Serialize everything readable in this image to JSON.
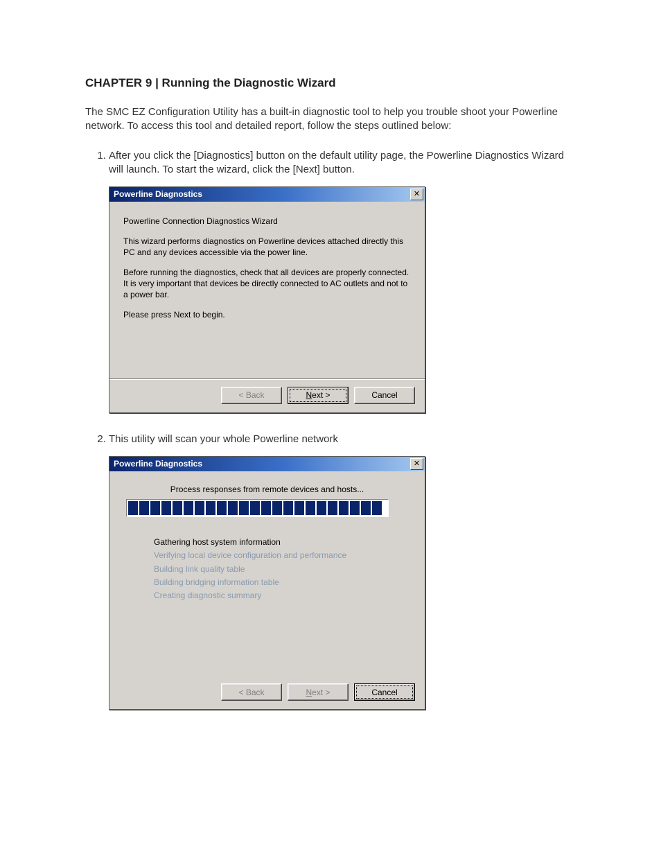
{
  "chapter_title": "CHAPTER 9 | Running the Diagnostic Wizard",
  "intro": "The SMC EZ Configuration Utility has a built-in diagnostic tool to help you trouble shoot your Powerline network.  To access this tool and detailed report, follow the steps outlined below:",
  "step1": "After you click the [Diagnostics] button on the default utility page, the Powerline Diagnostics Wizard will launch.  To start the wizard, click the [Next] button.",
  "step2": "This utility will scan your whole Powerline network",
  "dialog1": {
    "title": "Powerline Diagnostics",
    "heading": "Powerline Connection Diagnostics Wizard",
    "para1": "This wizard performs diagnostics on Powerline devices attached directly this PC and any devices accessible via the power line.",
    "para2": "Before running the diagnostics, check that all devices are properly connected. It is very important that devices be directly connected to AC outlets and not to a power bar.",
    "para3": "Please press Next to begin.",
    "back": "< Back",
    "next_prefix": "N",
    "next_suffix": "ext >",
    "cancel": "Cancel"
  },
  "dialog2": {
    "title": "Powerline Diagnostics",
    "status": "Process responses from remote devices and hosts...",
    "tasks": [
      {
        "label": "Gathering host system information",
        "state": "active"
      },
      {
        "label": "Verifying local device configuration and performance",
        "state": "pending"
      },
      {
        "label": "Building link quality table",
        "state": "pending"
      },
      {
        "label": "Building bridging information table",
        "state": "pending"
      },
      {
        "label": "Creating diagnostic summary",
        "state": "pending"
      }
    ],
    "back": "< Back",
    "next_prefix": "N",
    "next_suffix": "ext >",
    "cancel": "Cancel"
  }
}
